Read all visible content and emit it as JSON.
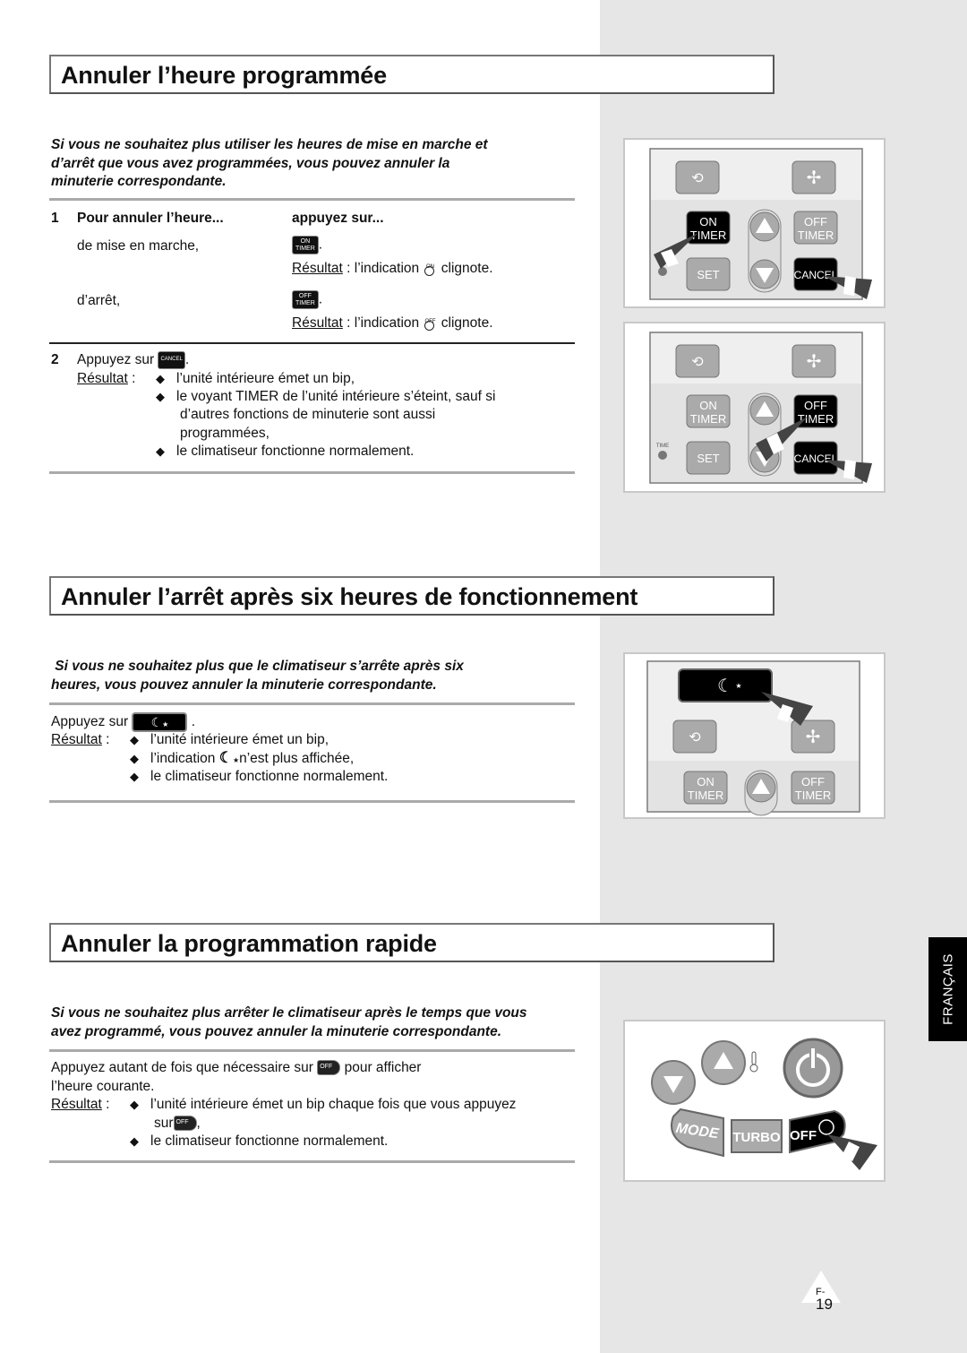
{
  "page": {
    "language_tab": "FRANÇAIS",
    "page_number": "19",
    "page_prefix": "F-"
  },
  "section1": {
    "title": "Annuler l’heure programmée",
    "intro_lines": [
      "Si vous ne souhaitez plus utiliser les heures de mise en marche et",
      "d’arrêt que vous avez programmées, vous pouvez annuler la",
      "minuterie correspondante."
    ],
    "step1": {
      "number": "1",
      "col1_header": "Pour annuler l’heure...",
      "col2_header": "appuyez sur...",
      "rows": [
        {
          "label": "de mise en marche,",
          "button_top": "ON",
          "button_bottom": "TIMER",
          "result_label": "Résultat",
          "result_text": " : l’indication ",
          "indicator": "ON",
          "result_end": " clignote."
        },
        {
          "label": "d’arrêt,",
          "button_top": "OFF",
          "button_bottom": "TIMER",
          "result_label": "Résultat",
          "result_text": " : l’indication ",
          "indicator": "OFF",
          "result_end": " clignote."
        }
      ]
    },
    "step2": {
      "number": "2",
      "text": "Appuyez sur ",
      "button": "CANCEL",
      "result_label": "Résultat",
      "bullets": [
        "l’unité intérieure émet un bip,",
        "le voyant TIMER de l’unité intérieure s’éteint, sauf si",
        "d’autres fonctions de minuterie sont aussi",
        "programmées,",
        "le climatiseur fonctionne normalement."
      ]
    },
    "remote1": {
      "on_timer": [
        "ON",
        "TIMER"
      ],
      "off_timer": [
        "OFF",
        "TIMER"
      ],
      "set": "SET",
      "cancel": "CANCEL"
    },
    "remote2": {
      "on_timer": [
        "ON",
        "TIMER"
      ],
      "off_timer": [
        "OFF",
        "TIMER"
      ],
      "set": "SET",
      "cancel": "CANCEL",
      "time_label": "TIME"
    }
  },
  "section2": {
    "title": "Annuler l’arrêt après six heures de fonctionnement",
    "intro_lines": [
      " Si vous ne souhaitez plus que le climatiseur s’arrête après six",
      "heures, vous pouvez annuler la minuterie correspondante."
    ],
    "text": "Appuyez sur ",
    "result_label": "Résultat",
    "bullets": [
      "l’unité intérieure émet un bip,",
      "l’indication ",
      "n’est plus affichée,",
      "le climatiseur fonctionne normalement."
    ],
    "remote": {
      "on_timer": [
        "ON",
        "TIMER"
      ],
      "off_timer": [
        "OFF",
        "TIMER"
      ]
    }
  },
  "section3": {
    "title": "Annuler la programmation rapide",
    "intro_lines": [
      "Si vous ne souhaitez plus arrêter le climatiseur après le temps que vous",
      "avez programmé, vous pouvez annuler la minuterie correspondante."
    ],
    "text_line1a": "Appuyez autant de fois que nécessaire sur ",
    "text_line1b": " pour afficher",
    "text_line2": "l’heure courante.",
    "result_label": "Résultat",
    "bullets": [
      "l’unité intérieure émet un bip chaque fois que vous appuyez",
      "sur",
      "le climatiseur fonctionne normalement."
    ],
    "off_button_label": "OFF",
    "remote": {
      "mode": "MODE",
      "turbo": "TURBO",
      "off": "OFF"
    }
  }
}
